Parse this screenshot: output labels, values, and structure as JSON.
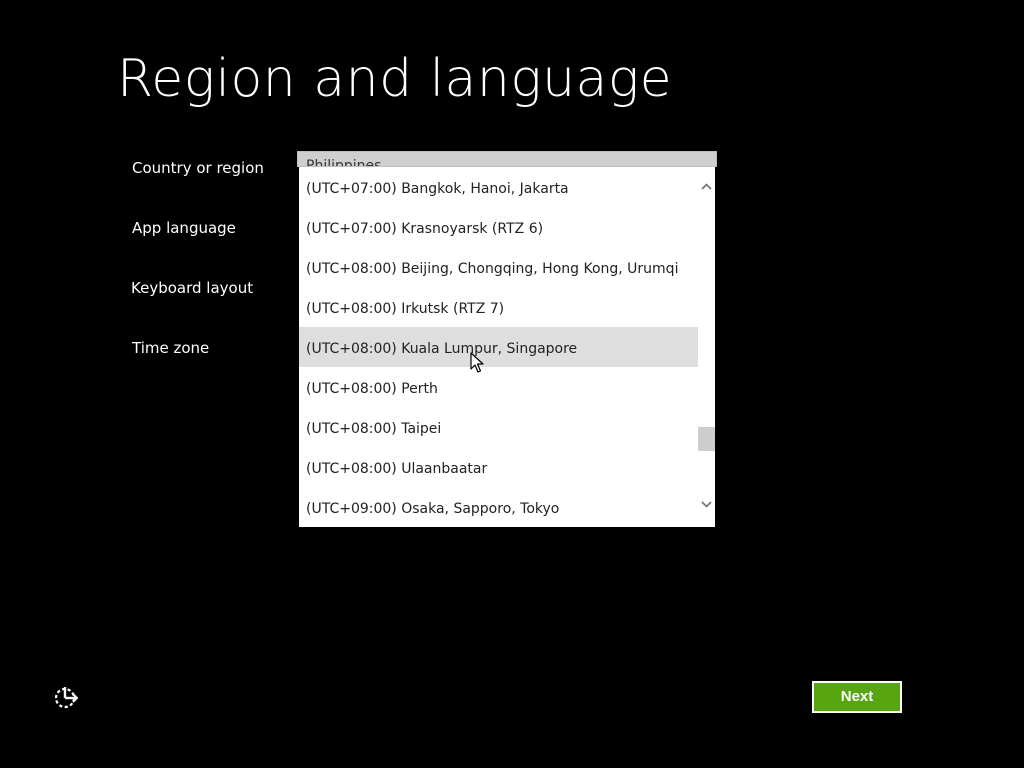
{
  "page": {
    "title": "Region and language",
    "background_color": "#000000"
  },
  "form": {
    "labels": [
      "Country or region",
      "App language",
      "Keyboard layout",
      "Time zone"
    ],
    "country_value": "Philippines"
  },
  "time_zone_dropdown": {
    "options": [
      "(UTC+07:00) Bangkok, Hanoi, Jakarta",
      "(UTC+07:00) Krasnoyarsk (RTZ 6)",
      "(UTC+08:00) Beijing, Chongqing, Hong Kong, Urumqi",
      "(UTC+08:00) Irkutsk (RTZ 7)",
      "(UTC+08:00) Kuala Lumpur, Singapore",
      "(UTC+08:00) Perth",
      "(UTC+08:00) Taipei",
      "(UTC+08:00) Ulaanbaatar",
      "(UTC+09:00) Osaka, Sapporo, Tokyo"
    ],
    "hovered_option": "(UTC+08:00) Kuala Lumpur, Singapore",
    "scroll_position_fraction": 0.85,
    "icons": {
      "scroll_up": "chevron-up-icon",
      "scroll_down": "chevron-down-icon"
    }
  },
  "footer": {
    "ease_of_access_icon": "ease-of-access-icon",
    "next_label": "Next",
    "next_color": "#58a512"
  }
}
